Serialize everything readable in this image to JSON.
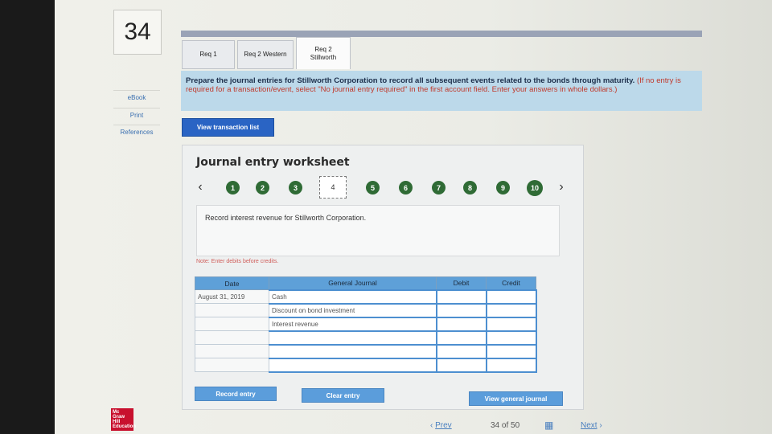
{
  "question": {
    "number": "34"
  },
  "sidebar": {
    "items": [
      {
        "label": "eBook"
      },
      {
        "label": "Print"
      },
      {
        "label": "References"
      }
    ]
  },
  "tabs": [
    {
      "label": "Req 1"
    },
    {
      "label": "Req 2 Western"
    },
    {
      "label": "Req 2 Stillworth",
      "active": true
    }
  ],
  "instructions": {
    "main": "Prepare the journal entries for Stillworth Corporation to record all subsequent events related to the bonds through maturity.",
    "hint": "(If no entry is required for a transaction/event, select \"No journal entry required\" in the first account field. Enter your answers in whole dollars.)"
  },
  "view_transaction_list": "View transaction list",
  "worksheet": {
    "title": "Journal entry worksheet",
    "steps": [
      "1",
      "2",
      "3",
      "4",
      "5",
      "6",
      "7",
      "8",
      "9",
      "10"
    ],
    "current_step": "4",
    "description": "Record interest revenue for Stillworth Corporation.",
    "note": "Note: Enter debits before credits.",
    "columns": {
      "date": "Date",
      "journal": "General Journal",
      "debit": "Debit",
      "credit": "Credit"
    },
    "rows": [
      {
        "date": "August 31, 2019",
        "account": "Cash",
        "debit": "",
        "credit": ""
      },
      {
        "date": "",
        "account": "Discount on bond investment",
        "debit": "",
        "credit": ""
      },
      {
        "date": "",
        "account": "Interest revenue",
        "debit": "",
        "credit": ""
      },
      {
        "date": "",
        "account": "",
        "debit": "",
        "credit": ""
      },
      {
        "date": "",
        "account": "",
        "debit": "",
        "credit": ""
      },
      {
        "date": "",
        "account": "",
        "debit": "",
        "credit": ""
      }
    ],
    "buttons": {
      "record": "Record entry",
      "clear": "Clear entry",
      "view_general": "View general journal"
    }
  },
  "footer": {
    "logo": "Mc Graw Hill Education",
    "prev": "Prev",
    "page_current": "34",
    "page_of": "of",
    "page_total": "50",
    "next": "Next"
  },
  "colors": {
    "accent": "#2a64c4",
    "step_done": "#2f6b35",
    "instruction_bg": "#bcd9ea"
  }
}
